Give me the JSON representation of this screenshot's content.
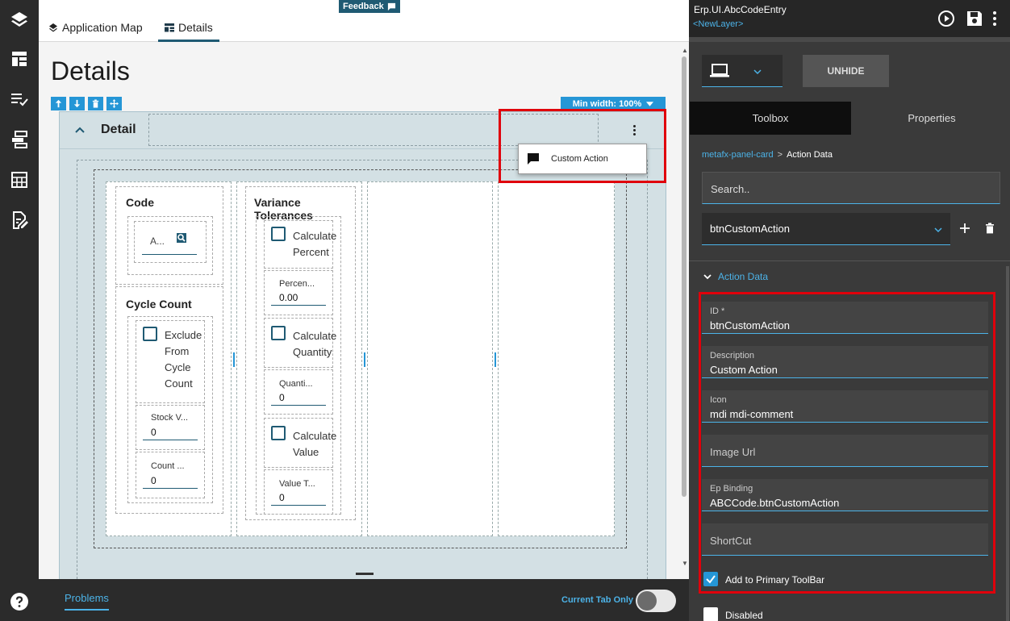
{
  "window": {
    "title": "Erp.UI.AbcCodeEntry",
    "layer": "<NewLayer>"
  },
  "topbar": {
    "feedback_label": "Feedback",
    "tabs": [
      {
        "label": "Application Map"
      },
      {
        "label": "Details"
      }
    ]
  },
  "page": {
    "title": "Details",
    "min_width_label": "Min width: 100%"
  },
  "card": {
    "title": "Detail",
    "menu": {
      "item_label": "Custom Action",
      "item_icon": "comment-icon"
    },
    "groups": {
      "code": {
        "title": "Code",
        "field_value": "A..."
      },
      "cycle_count": {
        "title": "Cycle Count",
        "exclude_label_lines": [
          "Exclude",
          "From",
          "Cycle",
          "Count"
        ],
        "stock_label": "Stock V...",
        "stock_value": "0",
        "count_label": "Count ...",
        "count_value": "0"
      },
      "variance": {
        "title": "Variance Tolerances",
        "calc_percent_lines": [
          "Calculate",
          "Percent"
        ],
        "percent_label": "Percen...",
        "percent_value": "0.00",
        "calc_qty_lines": [
          "Calculate",
          "Quantity"
        ],
        "qty_label": "Quanti...",
        "qty_value": "0",
        "calc_value_lines": [
          "Calculate",
          "Value"
        ],
        "value_label": "Value T...",
        "value_value": "0"
      }
    }
  },
  "bottombar": {
    "problems_label": "Problems",
    "current_tab_label": "Current Tab Only",
    "current_tab_on": false
  },
  "rpanel": {
    "unhide_label": "UNHIDE",
    "tabs": [
      {
        "label": "Toolbox"
      },
      {
        "label": "Properties"
      }
    ],
    "breadcrumb": {
      "link": "metafx-panel-card",
      "separator": ">",
      "current": "Action Data"
    },
    "search_placeholder": "Search..",
    "selected_action": "btnCustomAction",
    "section_title": "Action Data",
    "fields": [
      {
        "label": "ID *",
        "value": "btnCustomAction"
      },
      {
        "label": "Description",
        "value": "Custom Action"
      },
      {
        "label": "Icon",
        "value": "mdi mdi-comment"
      },
      {
        "label": "Image Url",
        "value": ""
      },
      {
        "label": "Ep Binding",
        "value": "ABCCode.btnCustomAction"
      },
      {
        "label": "ShortCut",
        "value": ""
      }
    ],
    "checkboxes": [
      {
        "label": "Add to Primary ToolBar",
        "checked": true
      },
      {
        "label": "Disabled",
        "checked": false
      }
    ]
  },
  "colors": {
    "accent": "#4cb3e8",
    "highlight": "#e0000b",
    "brand": "#1f5a73",
    "card_bg": "#d3e0e4",
    "panel_bg": "#3a3a3a"
  }
}
